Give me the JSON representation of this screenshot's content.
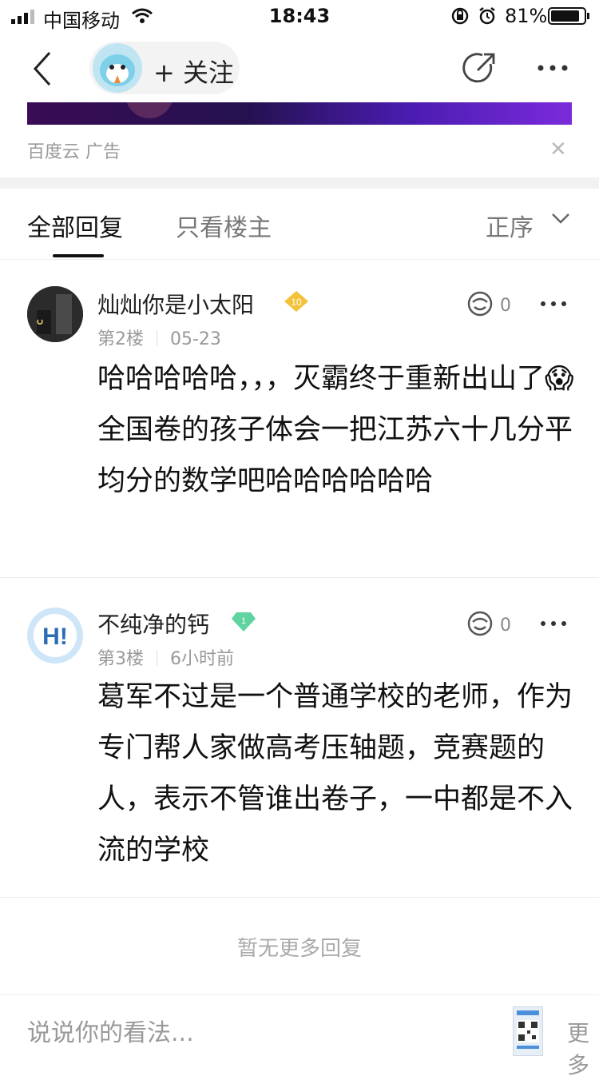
{
  "status_bar": {
    "carrier": "中国移动",
    "time": "18:43",
    "battery": "81%"
  },
  "nav": {
    "follow_label": "+ 关注"
  },
  "ad": {
    "source_label": "百度云   广告"
  },
  "tabs": {
    "all_replies": "全部回复",
    "op_only": "只看楼主",
    "order": "正序"
  },
  "posts": [
    {
      "username": "灿灿你是小太阳",
      "level_badge": "10",
      "floor": "第2楼",
      "date": "05-23",
      "like_count": "0",
      "body": "哈哈哈哈哈，，，灭霸终于重新出山了😱全国卷的孩子体会一把江苏六十几分平均分的数学吧哈哈哈哈哈哈"
    },
    {
      "username": "不纯净的钙",
      "level_badge": "1",
      "floor": "第3楼",
      "date": "6小时前",
      "like_count": "0",
      "body": "葛军不过是一个普通学校的老师，作为专门帮人家做高考压轴题，竞赛题的人，表示不管谁出卷子，一中都是不入流的学校"
    }
  ],
  "no_more": "暂无更多回复",
  "bottom": {
    "comment_placeholder": "说说你的看法...",
    "more_label": "更多"
  },
  "colors": {
    "gold_badge": "#f3c13a",
    "green_badge": "#5fd3a0",
    "accent_text": "#111111"
  }
}
